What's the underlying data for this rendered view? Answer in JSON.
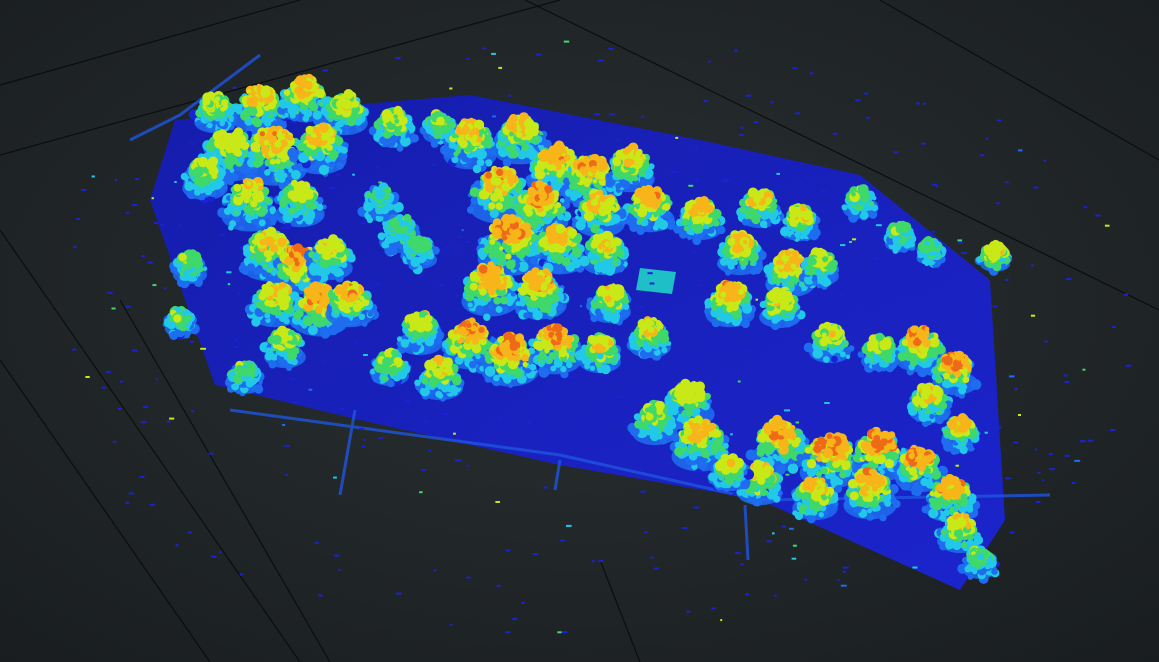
{
  "scene": {
    "kind": "lidar-point-cloud",
    "subject": "tree canopy",
    "color_mode": "height",
    "colormap": "jet",
    "colors": {
      "background": "#1f2426",
      "grid_line": "#0c0f10",
      "ground": "#1a22d6",
      "ground_dark": "#0d129a",
      "low": "#1e6df0",
      "mid_low": "#22c8e8",
      "mid": "#3fd86a",
      "mid_high": "#c9e817",
      "high": "#f7b51a",
      "top": "#ef6a18"
    },
    "colormap_stops": [
      "#0d129a",
      "#1a22d6",
      "#1e6df0",
      "#22c8e8",
      "#3fd86a",
      "#c9e817",
      "#f7b51a",
      "#ef6a18"
    ]
  }
}
